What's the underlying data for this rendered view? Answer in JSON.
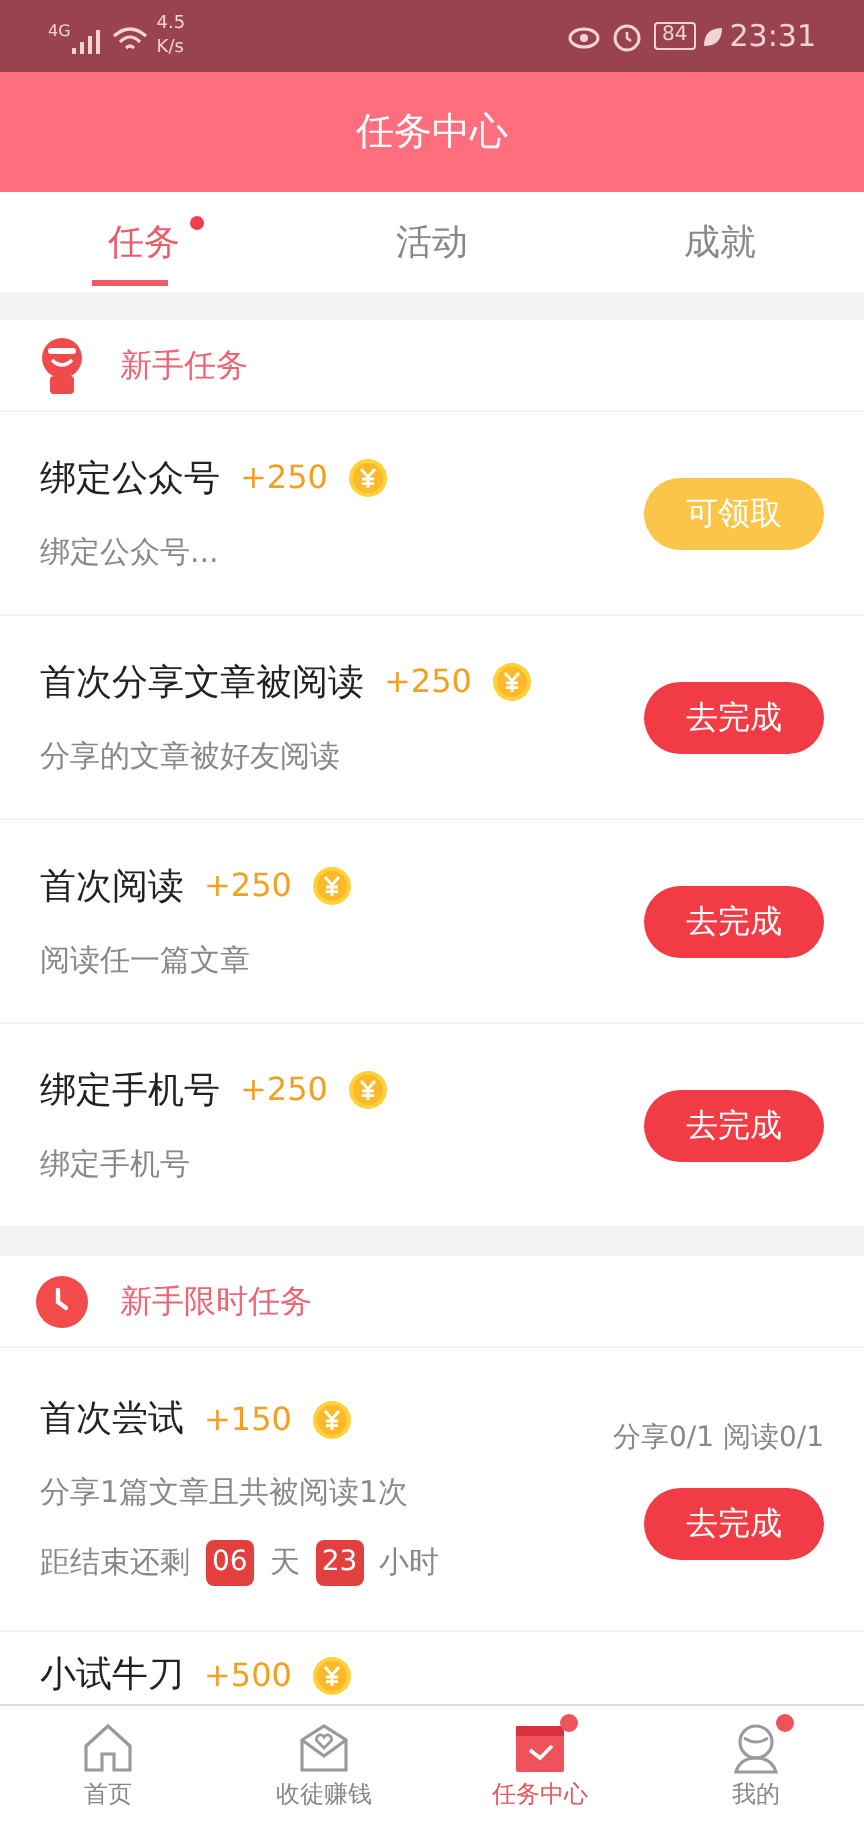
{
  "status_bar": {
    "network": "4G",
    "speed": "4.5",
    "speed_unit": "K/s",
    "battery": "84",
    "time": "23:31"
  },
  "header": {
    "title": "任务中心"
  },
  "tabs": [
    {
      "label": "任务",
      "selected": true,
      "dot": true
    },
    {
      "label": "活动",
      "selected": false,
      "dot": false
    },
    {
      "label": "成就",
      "selected": false,
      "dot": false
    }
  ],
  "sections": [
    {
      "title": "新手任务",
      "kind": "new",
      "tasks": [
        {
          "title": "绑定公众号",
          "points": "+250",
          "desc": "绑定公众号...",
          "button": {
            "label": "可领取",
            "kind": "claim"
          }
        },
        {
          "title": "首次分享文章被阅读",
          "points": "+250",
          "desc": "分享的文章被好友阅读",
          "button": {
            "label": "去完成",
            "kind": "go"
          }
        },
        {
          "title": "首次阅读",
          "points": "+250",
          "desc": "阅读任一篇文章",
          "button": {
            "label": "去完成",
            "kind": "go"
          }
        },
        {
          "title": "绑定手机号",
          "points": "+250",
          "desc": "绑定手机号",
          "button": {
            "label": "去完成",
            "kind": "go"
          }
        }
      ]
    },
    {
      "title": "新手限时任务",
      "kind": "clock",
      "tasks": [
        {
          "title": "首次尝试",
          "points": "+150",
          "desc": "分享1篇文章且共被阅读1次",
          "progress": "分享0/1 阅读0/1",
          "countdown": [
            {
              "kind": "text",
              "text": "距结束还剩"
            },
            {
              "kind": "badge",
              "text": "06"
            },
            {
              "kind": "text",
              "text": "天"
            },
            {
              "kind": "badge",
              "text": "23"
            },
            {
              "kind": "text",
              "text": "小时"
            }
          ],
          "button": {
            "label": "去完成",
            "kind": "go"
          }
        },
        {
          "title": "小试牛刀",
          "points": "+500"
        }
      ]
    }
  ],
  "nav": [
    {
      "label": "首页",
      "selected": false,
      "dot": false
    },
    {
      "label": "收徒赚钱",
      "selected": false,
      "dot": false
    },
    {
      "label": "任务中心",
      "selected": true,
      "dot": true
    },
    {
      "label": "我的",
      "selected": false,
      "dot": true
    }
  ]
}
